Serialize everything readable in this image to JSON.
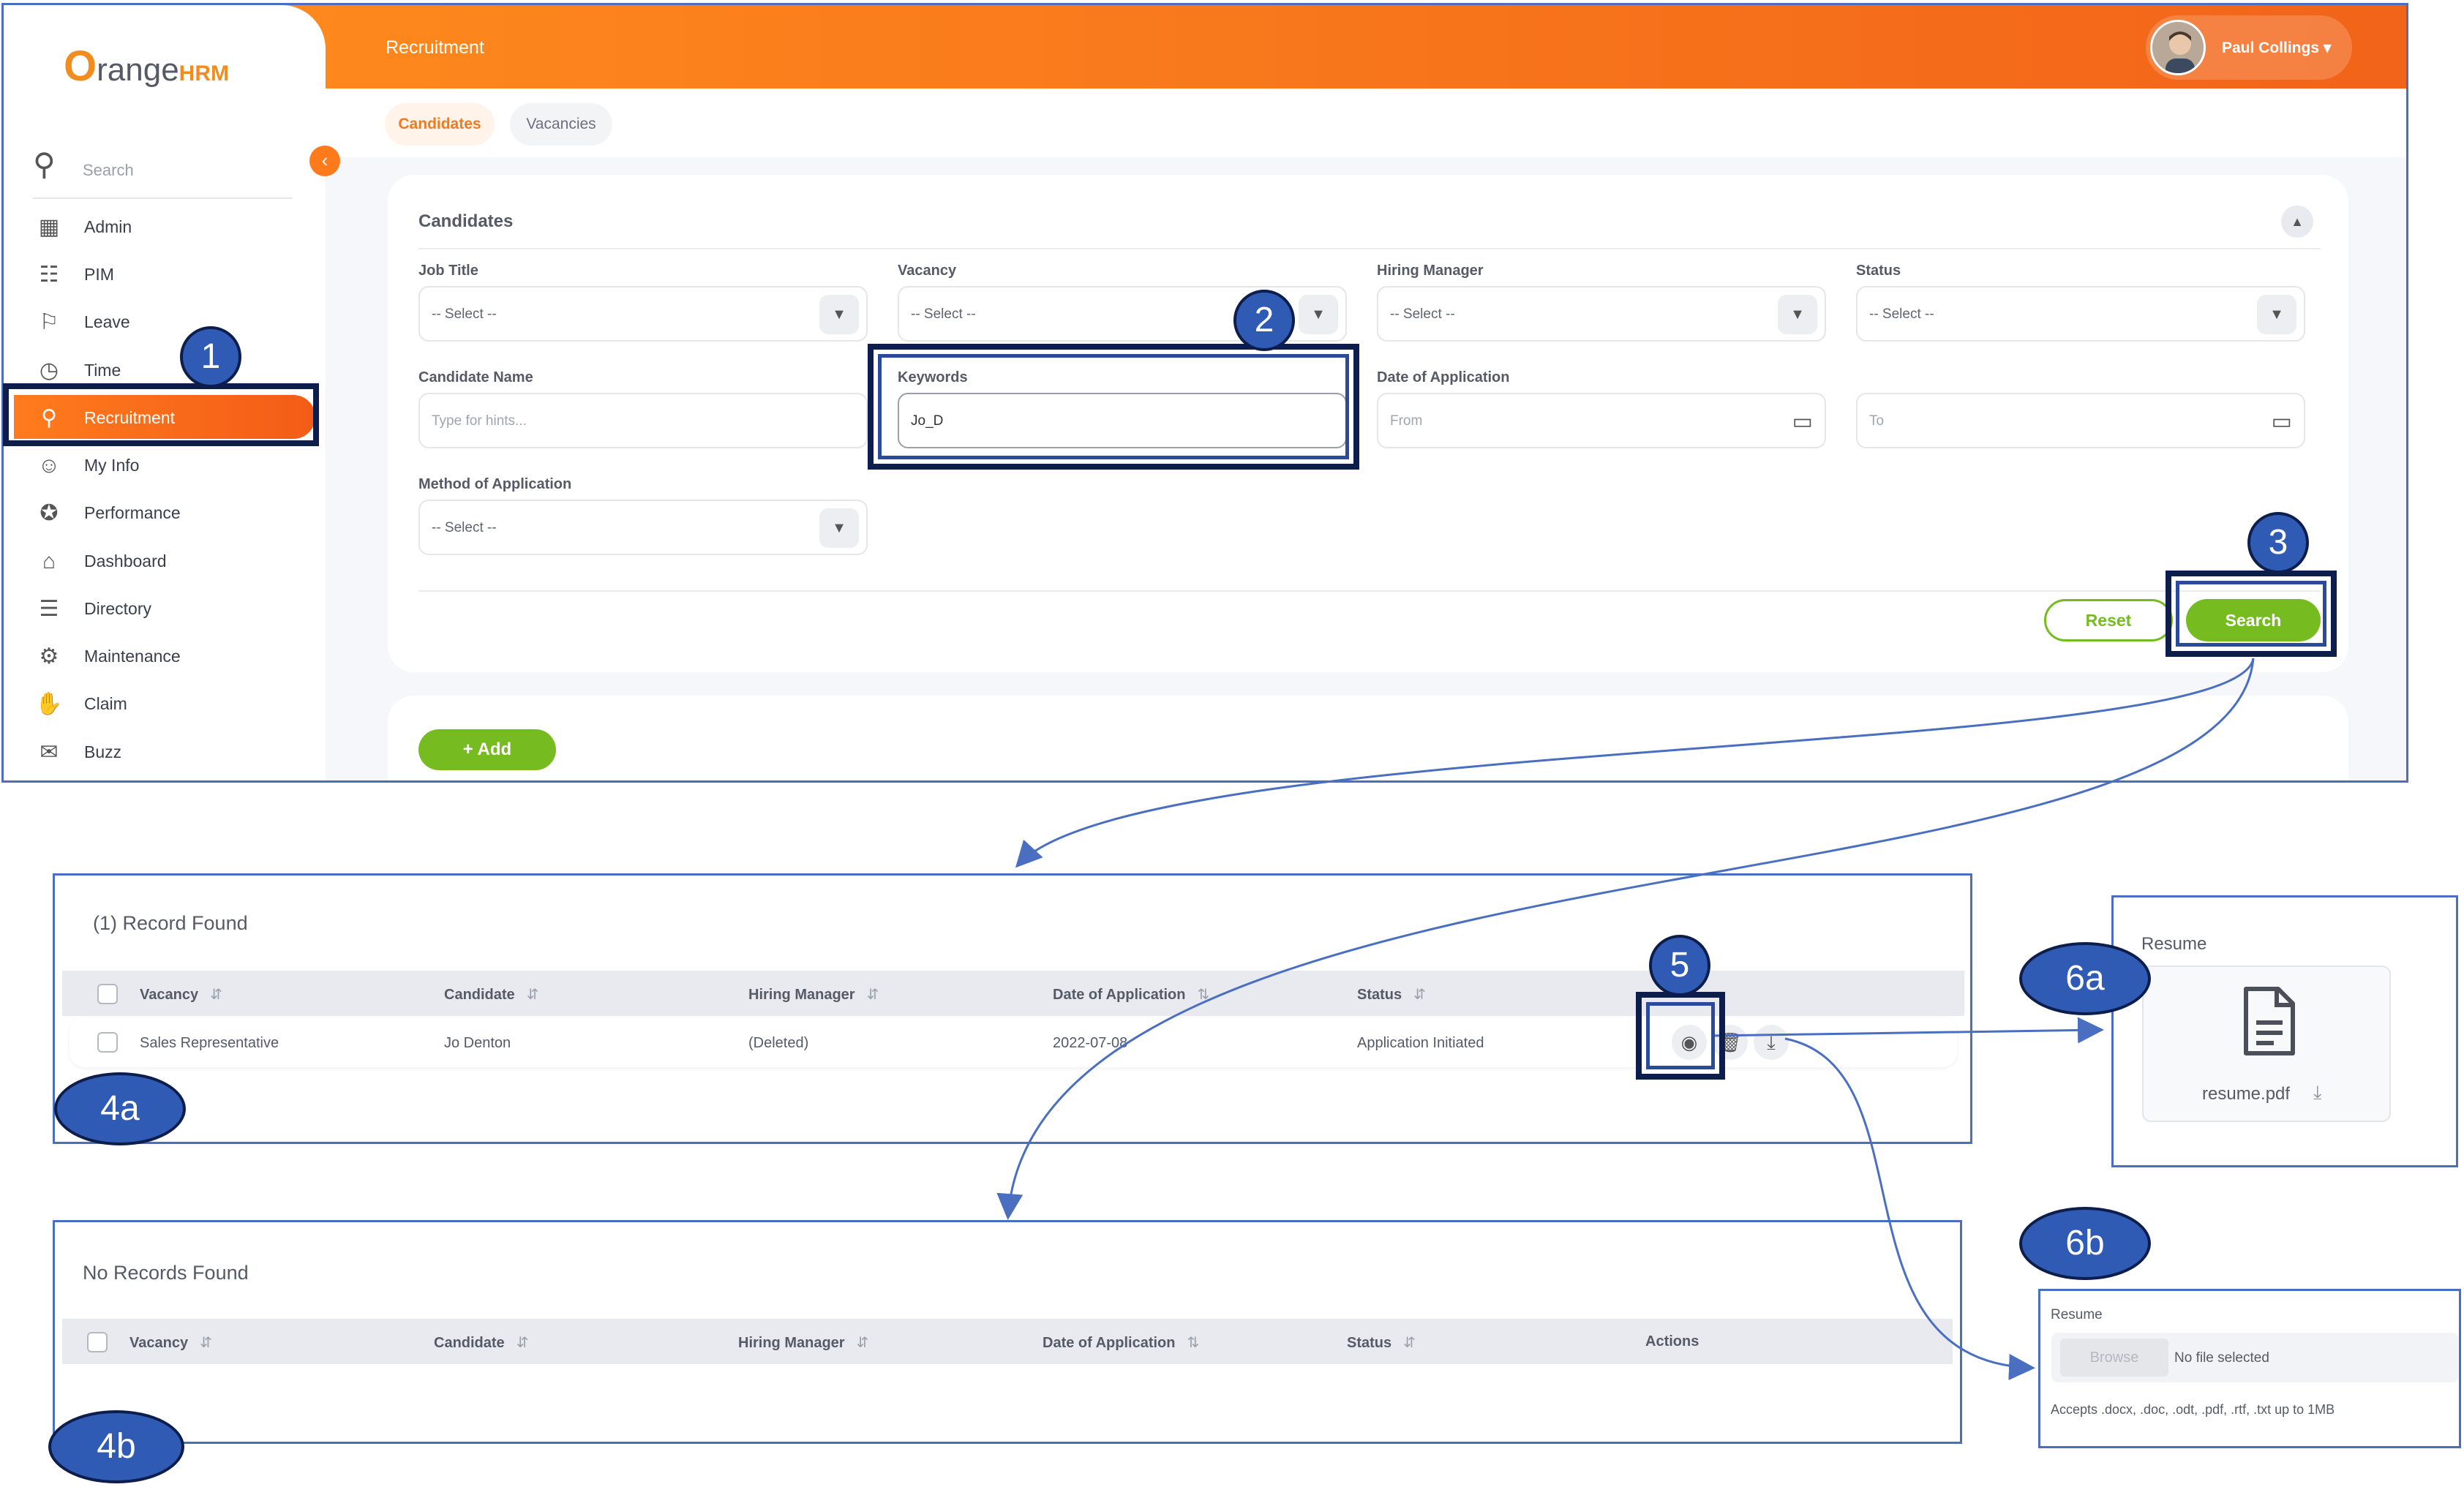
{
  "app": {
    "logo": {
      "o": "O",
      "range": "range",
      "hrm": "HRM"
    },
    "topbar_title": "Recruitment",
    "user_name": "Paul Collings",
    "sidebar": {
      "search_placeholder": "Search",
      "items": [
        {
          "label": "Admin",
          "icon": "admin-icon"
        },
        {
          "label": "PIM",
          "icon": "pim-icon"
        },
        {
          "label": "Leave",
          "icon": "leave-icon"
        },
        {
          "label": "Time",
          "icon": "time-icon"
        },
        {
          "label": "Recruitment",
          "icon": "recruitment-icon",
          "active": true
        },
        {
          "label": "My Info",
          "icon": "my-info-icon"
        },
        {
          "label": "Performance",
          "icon": "performance-icon"
        },
        {
          "label": "Dashboard",
          "icon": "dashboard-icon"
        },
        {
          "label": "Directory",
          "icon": "directory-icon"
        },
        {
          "label": "Maintenance",
          "icon": "maintenance-icon"
        },
        {
          "label": "Claim",
          "icon": "claim-icon"
        },
        {
          "label": "Buzz",
          "icon": "buzz-icon"
        }
      ]
    },
    "tabs": {
      "candidates": "Candidates",
      "vacancies": "Vacancies"
    },
    "help": "?",
    "filter": {
      "title": "Candidates",
      "job_title_label": "Job Title",
      "job_title_value": "-- Select --",
      "vacancy_label": "Vacancy",
      "vacancy_value": "-- Select --",
      "hiring_manager_label": "Hiring Manager",
      "hiring_manager_value": "-- Select --",
      "status_label": "Status",
      "status_value": "-- Select --",
      "candidate_name_label": "Candidate Name",
      "candidate_name_placeholder": "Type for hints...",
      "keywords_label": "Keywords",
      "keywords_value": "Jo_D",
      "date_label": "Date of Application",
      "date_from_placeholder": "From",
      "date_to_placeholder": "To",
      "method_label": "Method of Application",
      "method_value": "-- Select --",
      "reset": "Reset",
      "search": "Search"
    },
    "add_button": "+ Add"
  },
  "annotations": [
    "1",
    "2",
    "3",
    "4a",
    "4b",
    "5",
    "6a",
    "6b"
  ],
  "results_found": {
    "title": "(1) Record Found",
    "headers": [
      "Vacancy",
      "Candidate",
      "Hiring Manager",
      "Date of Application",
      "Status"
    ],
    "row": {
      "vacancy": "Sales Representative",
      "candidate": "Jo Denton",
      "hiring_manager": "(Deleted)",
      "date": "2022-07-08",
      "status": "Application Initiated"
    }
  },
  "results_none": {
    "title": "No Records Found",
    "headers": [
      "Vacancy",
      "Candidate",
      "Hiring Manager",
      "Date of Application",
      "Status",
      "Actions"
    ]
  },
  "resume_view": {
    "label": "Resume",
    "filename": "resume.pdf"
  },
  "resume_upload": {
    "label": "Resume",
    "browse": "Browse",
    "no_file": "No file selected",
    "accepts": "Accepts .docx, .doc, .odt, .pdf, .rtf, .txt up to 1MB"
  },
  "colors": {
    "accent": "#f27a1e",
    "green": "#76bc21",
    "annotation": "#2f5bb5",
    "frame": "#4a6fc1"
  }
}
